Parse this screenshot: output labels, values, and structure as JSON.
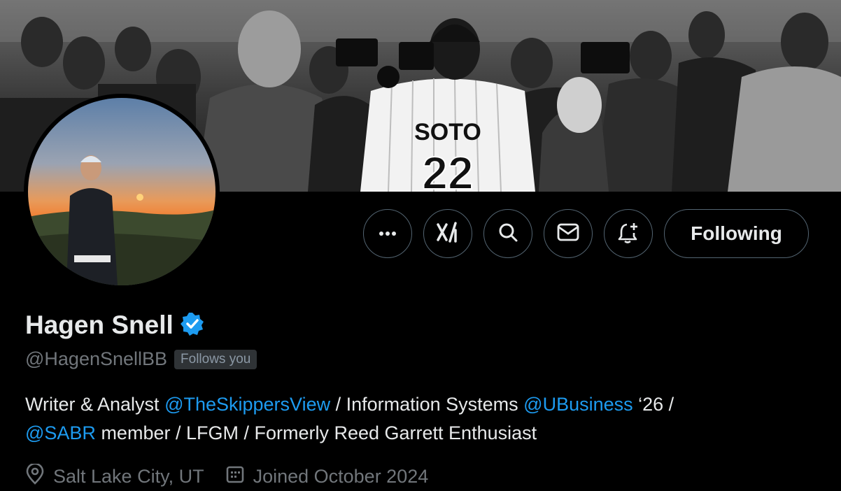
{
  "banner": {
    "jersey_name": "SOTO",
    "jersey_number": "22"
  },
  "actions": {
    "more_icon": "more-horizontal-icon",
    "grok_icon": "xai-grok-icon",
    "search_icon": "search-icon",
    "message_icon": "mail-icon",
    "notify_icon": "bell-plus-icon",
    "following_label": "Following"
  },
  "profile": {
    "display_name": "Hagen Snell",
    "verified": true,
    "handle": "@HagenSnellBB",
    "follows_you": "Follows you",
    "bio": {
      "t1": "Writer & Analyst ",
      "m1": "@TheSkippersView",
      "t2": " / Information Systems ",
      "m2": "@UBusiness",
      "t3": " ‘26 /",
      "m3": "@SABR",
      "t4": " member / LFGM / Formerly Reed Garrett Enthusiast"
    },
    "location": "Salt Lake City, UT",
    "joined": "Joined October 2024"
  },
  "colors": {
    "background": "#000000",
    "accent": "#1d9bf0",
    "muted": "#71767b",
    "border": "#536471"
  }
}
